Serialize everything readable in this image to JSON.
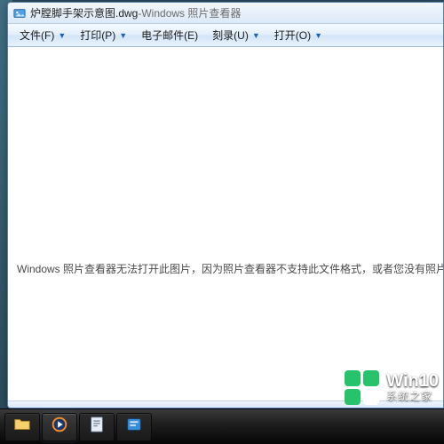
{
  "window": {
    "filename": "炉膛脚手架示意图.dwg",
    "app_name": "Windows 照片查看器",
    "title_separator": " - "
  },
  "menubar": {
    "items": [
      {
        "label": "文件(F)",
        "name": "menu-file"
      },
      {
        "label": "打印(P)",
        "name": "menu-print"
      },
      {
        "label": "电子邮件(E)",
        "name": "menu-email"
      },
      {
        "label": "刻录(U)",
        "name": "menu-burn"
      },
      {
        "label": "打开(O)",
        "name": "menu-open"
      }
    ]
  },
  "content": {
    "error_message": "Windows 照片查看器无法打开此图片，因为照片查看器不支持此文件格式，或者您没有照片查看器的"
  },
  "taskbar": {
    "items": [
      {
        "name": "tb-explorer",
        "icon": "folder-icon"
      },
      {
        "name": "tb-wmp",
        "icon": "wmp-icon"
      },
      {
        "name": "tb-app1",
        "icon": "doc-icon"
      },
      {
        "name": "tb-app2",
        "icon": "gen-icon"
      }
    ]
  },
  "watermark": {
    "brand": "Win10",
    "subtitle": "系统之家"
  }
}
